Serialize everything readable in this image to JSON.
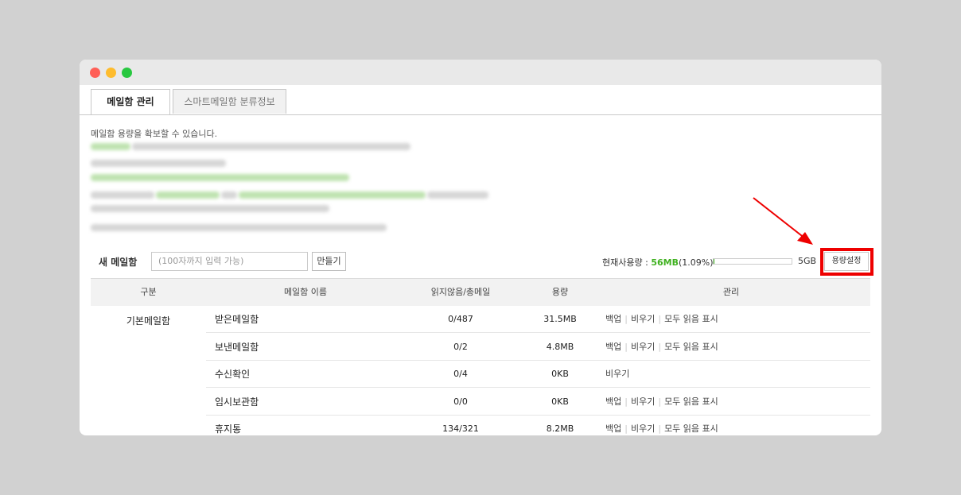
{
  "tabs": [
    {
      "label": "메일함 관리"
    },
    {
      "label": "스마트메일함 분류정보"
    }
  ],
  "intro": "메일함 용량을 확보할 수 있습니다.",
  "new_mailbox": {
    "label": "새 메일함",
    "placeholder": "(100자까지 입력 가능)",
    "button": "만들기"
  },
  "usage": {
    "label": "현재사용량 :",
    "used": "56MB",
    "percent": "(1.09%)",
    "total": "5GB",
    "fraction": 0.0109,
    "button": "용량설정",
    "accent": "#3fb11f",
    "highlight_color": "#ee0000"
  },
  "table": {
    "headers": {
      "category": "구분",
      "name": "메일함 이름",
      "count": "읽지않음/총메일",
      "size": "용량",
      "manage": "관리"
    },
    "category": "기본메일함",
    "rows": [
      {
        "name": "받은메일함",
        "count": "0/487",
        "size": "31.5MB",
        "actions": [
          "백업",
          "비우기",
          "모두 읽음 표시"
        ]
      },
      {
        "name": "보낸메일함",
        "count": "0/2",
        "size": "4.8MB",
        "actions": [
          "백업",
          "비우기",
          "모두 읽음 표시"
        ]
      },
      {
        "name": "수신확인",
        "count": "0/4",
        "size": "0KB",
        "actions": [
          "비우기"
        ]
      },
      {
        "name": "임시보관함",
        "count": "0/0",
        "size": "0KB",
        "actions": [
          "백업",
          "비우기",
          "모두 읽음 표시"
        ]
      },
      {
        "name": "휴지통",
        "count": "134/321",
        "size": "8.2MB",
        "actions": [
          "백업",
          "비우기",
          "모두 읽음 표시"
        ]
      }
    ]
  }
}
